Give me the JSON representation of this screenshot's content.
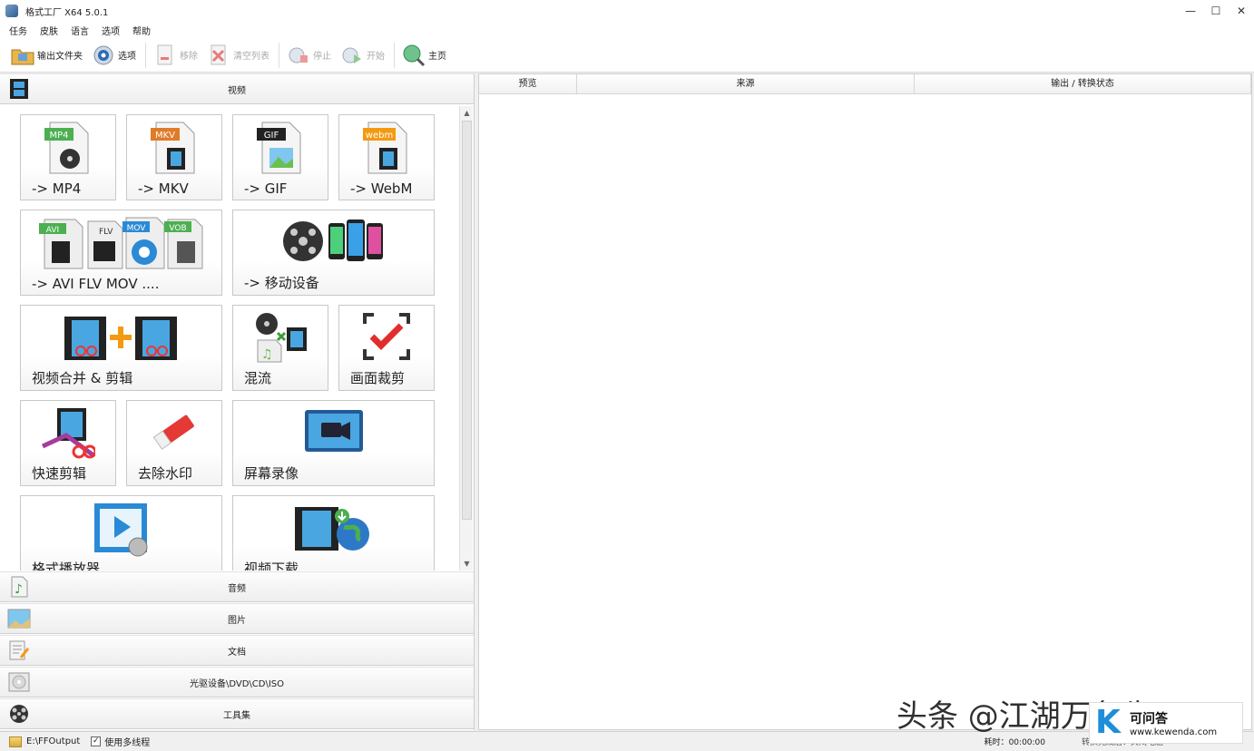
{
  "window": {
    "title": "格式工厂 X64 5.0.1",
    "minimize": "—",
    "maximize": "☐",
    "close": "✕"
  },
  "menu": [
    "任务",
    "皮肤",
    "语言",
    "选项",
    "帮助"
  ],
  "toolbar": {
    "output_folder": "输出文件夹",
    "options": "选项",
    "remove": "移除",
    "clear_list": "清空列表",
    "stop": "停止",
    "start": "开始",
    "home": "主页"
  },
  "categories": {
    "video": "视频",
    "audio": "音频",
    "picture": "图片",
    "document": "文档",
    "disc": "光驱设备\\DVD\\CD\\ISO",
    "tools": "工具集"
  },
  "tiles": [
    {
      "label": "-> MP4",
      "badge": "MP4",
      "badge_color": "#4caf50"
    },
    {
      "label": "-> MKV",
      "badge": "MKV",
      "badge_color": "#e07b29"
    },
    {
      "label": "-> GIF",
      "badge": "GIF",
      "badge_color": "#222222"
    },
    {
      "label": "-> WebM",
      "badge": "webm",
      "badge_color": "#f39a12"
    },
    {
      "label": "-> AVI FLV MOV ....",
      "badges": [
        "AVI",
        "FLV",
        "MOV",
        "VOB"
      ]
    },
    {
      "label": "-> 移动设备"
    },
    {
      "label": "视频合并 & 剪辑"
    },
    {
      "label": "混流"
    },
    {
      "label": "画面裁剪"
    },
    {
      "label": "快速剪辑"
    },
    {
      "label": "去除水印"
    },
    {
      "label": "屏幕录像"
    },
    {
      "label": "格式播放器"
    },
    {
      "label": "视频下载"
    }
  ],
  "table": {
    "columns": [
      "预览",
      "来源",
      "输出 / 转换状态"
    ]
  },
  "status": {
    "output_path": "E:\\FFOutput",
    "multithread_label": "使用多线程",
    "multithread_checked": "✓",
    "elapsed": "耗时：00:00:00",
    "after_convert": "转换完成后：关闭电脑"
  },
  "watermark": {
    "text": "头条 @江湖万象生Vl",
    "badge_letter": "K",
    "badge_title": "可问答",
    "badge_url": "www.kewenda.com"
  },
  "colors": {
    "accent_blue": "#1d8fd8",
    "border": "#c8c8c8"
  }
}
